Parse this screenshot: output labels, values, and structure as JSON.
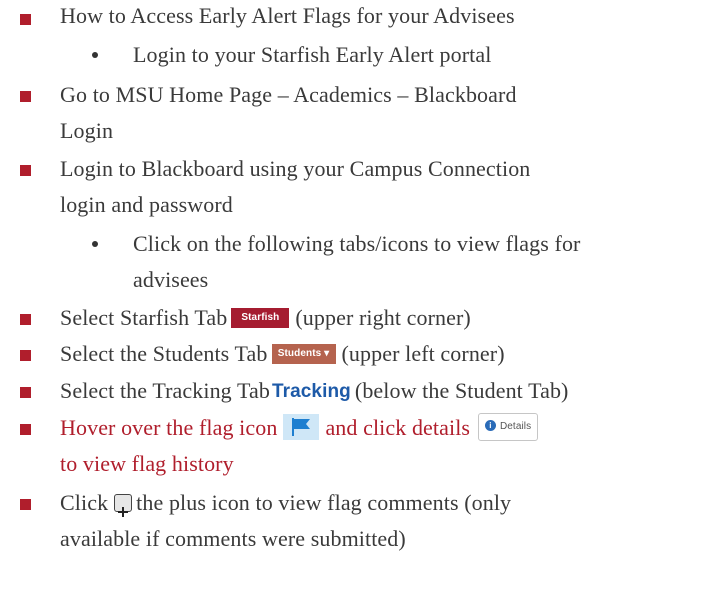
{
  "items": [
    {
      "type": "square",
      "text": "How to Access Early Alert Flags for your Advisees"
    },
    {
      "type": "bullet",
      "text": "Login to your Starfish Early Alert portal"
    },
    {
      "type": "square",
      "lines": [
        "Go to MSU Home Page – Academics – Blackboard",
        "Login"
      ]
    },
    {
      "type": "square",
      "lines": [
        "Login to Blackboard using your Campus Connection",
        "login and password"
      ]
    },
    {
      "type": "bullet",
      "lines": [
        "Click on the following tabs/icons to view flags for",
        "advisees"
      ]
    },
    {
      "type": "square",
      "pre": "Select Starfish Tab",
      "icon_label": "Starfish",
      "post": "(upper right corner)"
    },
    {
      "type": "square",
      "pre": "Select the Students Tab",
      "icon_label": "Students ▾",
      "post": "(upper left corner)"
    },
    {
      "type": "square",
      "pre": "Select the Tracking Tab",
      "icon_label": "Tracking",
      "post": "(below the Student Tab)"
    },
    {
      "type": "square",
      "pre": "Hover over the flag icon",
      "mid": "and click details",
      "button_label": "Details",
      "line2": "to view flag history"
    },
    {
      "type": "square",
      "pre": "Click",
      "post": "the plus icon to view flag comments (only",
      "line2": "available if comments were submitted)"
    }
  ],
  "colors": {
    "bullet_square": "#b01e2c",
    "highlight_text": "#b01e2c",
    "body_text": "#3a3a3a"
  },
  "icons": {
    "flag": "flag-icon",
    "info": "info-icon",
    "plus": "plus-box-icon"
  }
}
